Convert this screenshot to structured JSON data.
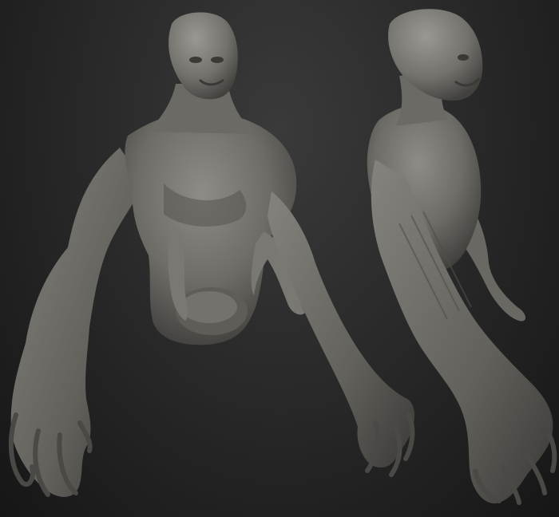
{
  "scene": {
    "subject": "creature-sculpt",
    "views": [
      {
        "name": "front-view"
      },
      {
        "name": "three-quarter-view"
      }
    ],
    "colors": {
      "background_top": "#3a3a3a",
      "background_bottom": "#161616",
      "clay_light": "#8c8a85",
      "clay_mid": "#6b6964",
      "clay_dark": "#3f3e3b"
    }
  }
}
